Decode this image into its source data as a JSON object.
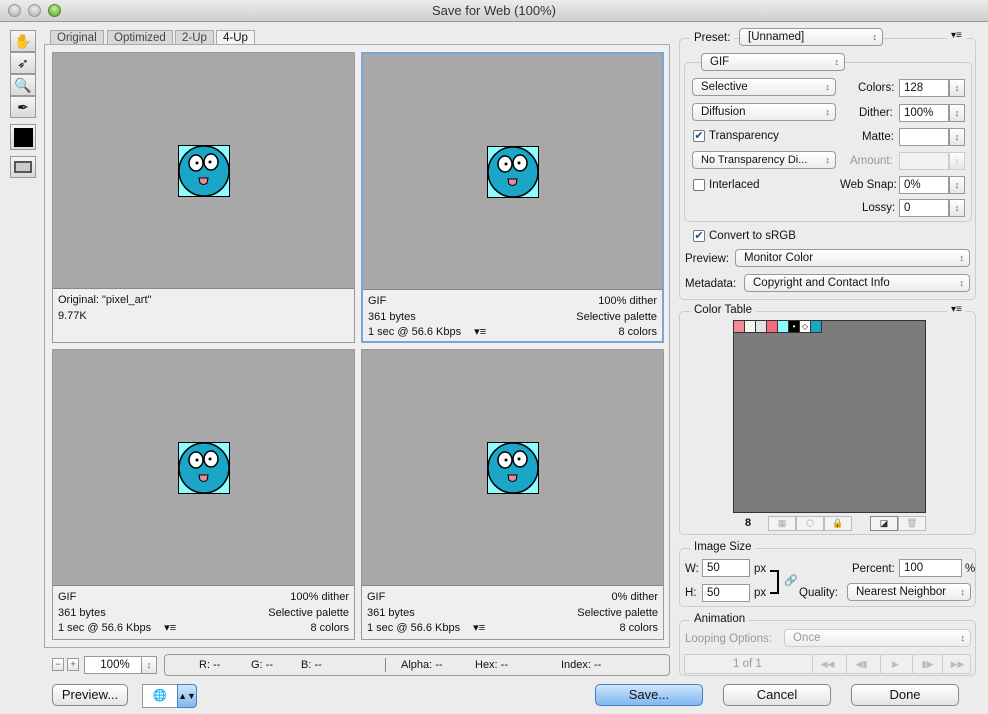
{
  "window": {
    "title": "Save for Web (100%)"
  },
  "tools": [
    {
      "icon": "hand-icon"
    },
    {
      "icon": "slice-select-icon"
    },
    {
      "icon": "zoom-icon"
    },
    {
      "icon": "eyedropper-icon"
    },
    {
      "icon": "eyedropper-color-swatch-icon"
    },
    {
      "icon": "toggle-slices-icon"
    }
  ],
  "tabs": [
    "Original",
    "Optimized",
    "2-Up",
    "4-Up"
  ],
  "active_tab": "4-Up",
  "panels": [
    {
      "l1": "Original: \"pixel_art\"",
      "r1": "",
      "l2": "9.77K",
      "r2": "",
      "l3": "",
      "r3": ""
    },
    {
      "l1": "GIF",
      "r1": "100% dither",
      "l2": "361 bytes",
      "r2": "Selective palette",
      "l3": "1 sec @ 56.6 Kbps",
      "r3": "8 colors"
    },
    {
      "l1": "GIF",
      "r1": "100% dither",
      "l2": "361 bytes",
      "r2": "Selective palette",
      "l3": "1 sec @ 56.6 Kbps",
      "r3": "8 colors"
    },
    {
      "l1": "GIF",
      "r1": "0% dither",
      "l2": "361 bytes",
      "r2": "Selective palette",
      "l3": "1 sec @ 56.6 Kbps",
      "r3": "8 colors"
    }
  ],
  "status": {
    "zoom": "100%",
    "r": "R: --",
    "g": "G: --",
    "b": "B: --",
    "alpha": "Alpha: --",
    "hex": "Hex: --",
    "index": "Index: --"
  },
  "buttons": {
    "preview": "Preview...",
    "save": "Save...",
    "cancel": "Cancel",
    "done": "Done"
  },
  "settings": {
    "preset_label": "Preset:",
    "preset": "[Unnamed]",
    "format": "GIF",
    "reduction": "Selective",
    "dither_algo": "Diffusion",
    "colors_label": "Colors:",
    "colors": "128",
    "dither_label": "Dither:",
    "dither": "100%",
    "transparency_label": "Transparency",
    "transparency": true,
    "matte_label": "Matte:",
    "matte": "",
    "trans_dither": "No Transparency Di...",
    "amount_label": "Amount:",
    "amount": "",
    "interlaced_label": "Interlaced",
    "interlaced": false,
    "websnap_label": "Web Snap:",
    "websnap": "0%",
    "lossy_label": "Lossy:",
    "lossy": "0",
    "srgb_label": "Convert to sRGB",
    "srgb": true,
    "preview_label": "Preview:",
    "preview": "Monitor Color",
    "metadata_label": "Metadata:",
    "metadata": "Copyright and Contact Info"
  },
  "color_table": {
    "title": "Color Table",
    "count": "8",
    "colors": [
      "#f48a95",
      "#f4f4f4",
      "#e2e2e2",
      "#f36b7e",
      "#8efcfc",
      "#000000",
      "#ffffff",
      "#1ba6c8"
    ]
  },
  "image_size": {
    "title": "Image Size",
    "w_label": "W:",
    "w": "50",
    "h_label": "H:",
    "h": "50",
    "unit": "px",
    "percent_label": "Percent:",
    "percent": "100",
    "pct": "%",
    "quality_label": "Quality:",
    "quality": "Nearest Neighbor"
  },
  "animation": {
    "title": "Animation",
    "looping_label": "Looping Options:",
    "looping": "Once",
    "frame": "1 of 1"
  }
}
